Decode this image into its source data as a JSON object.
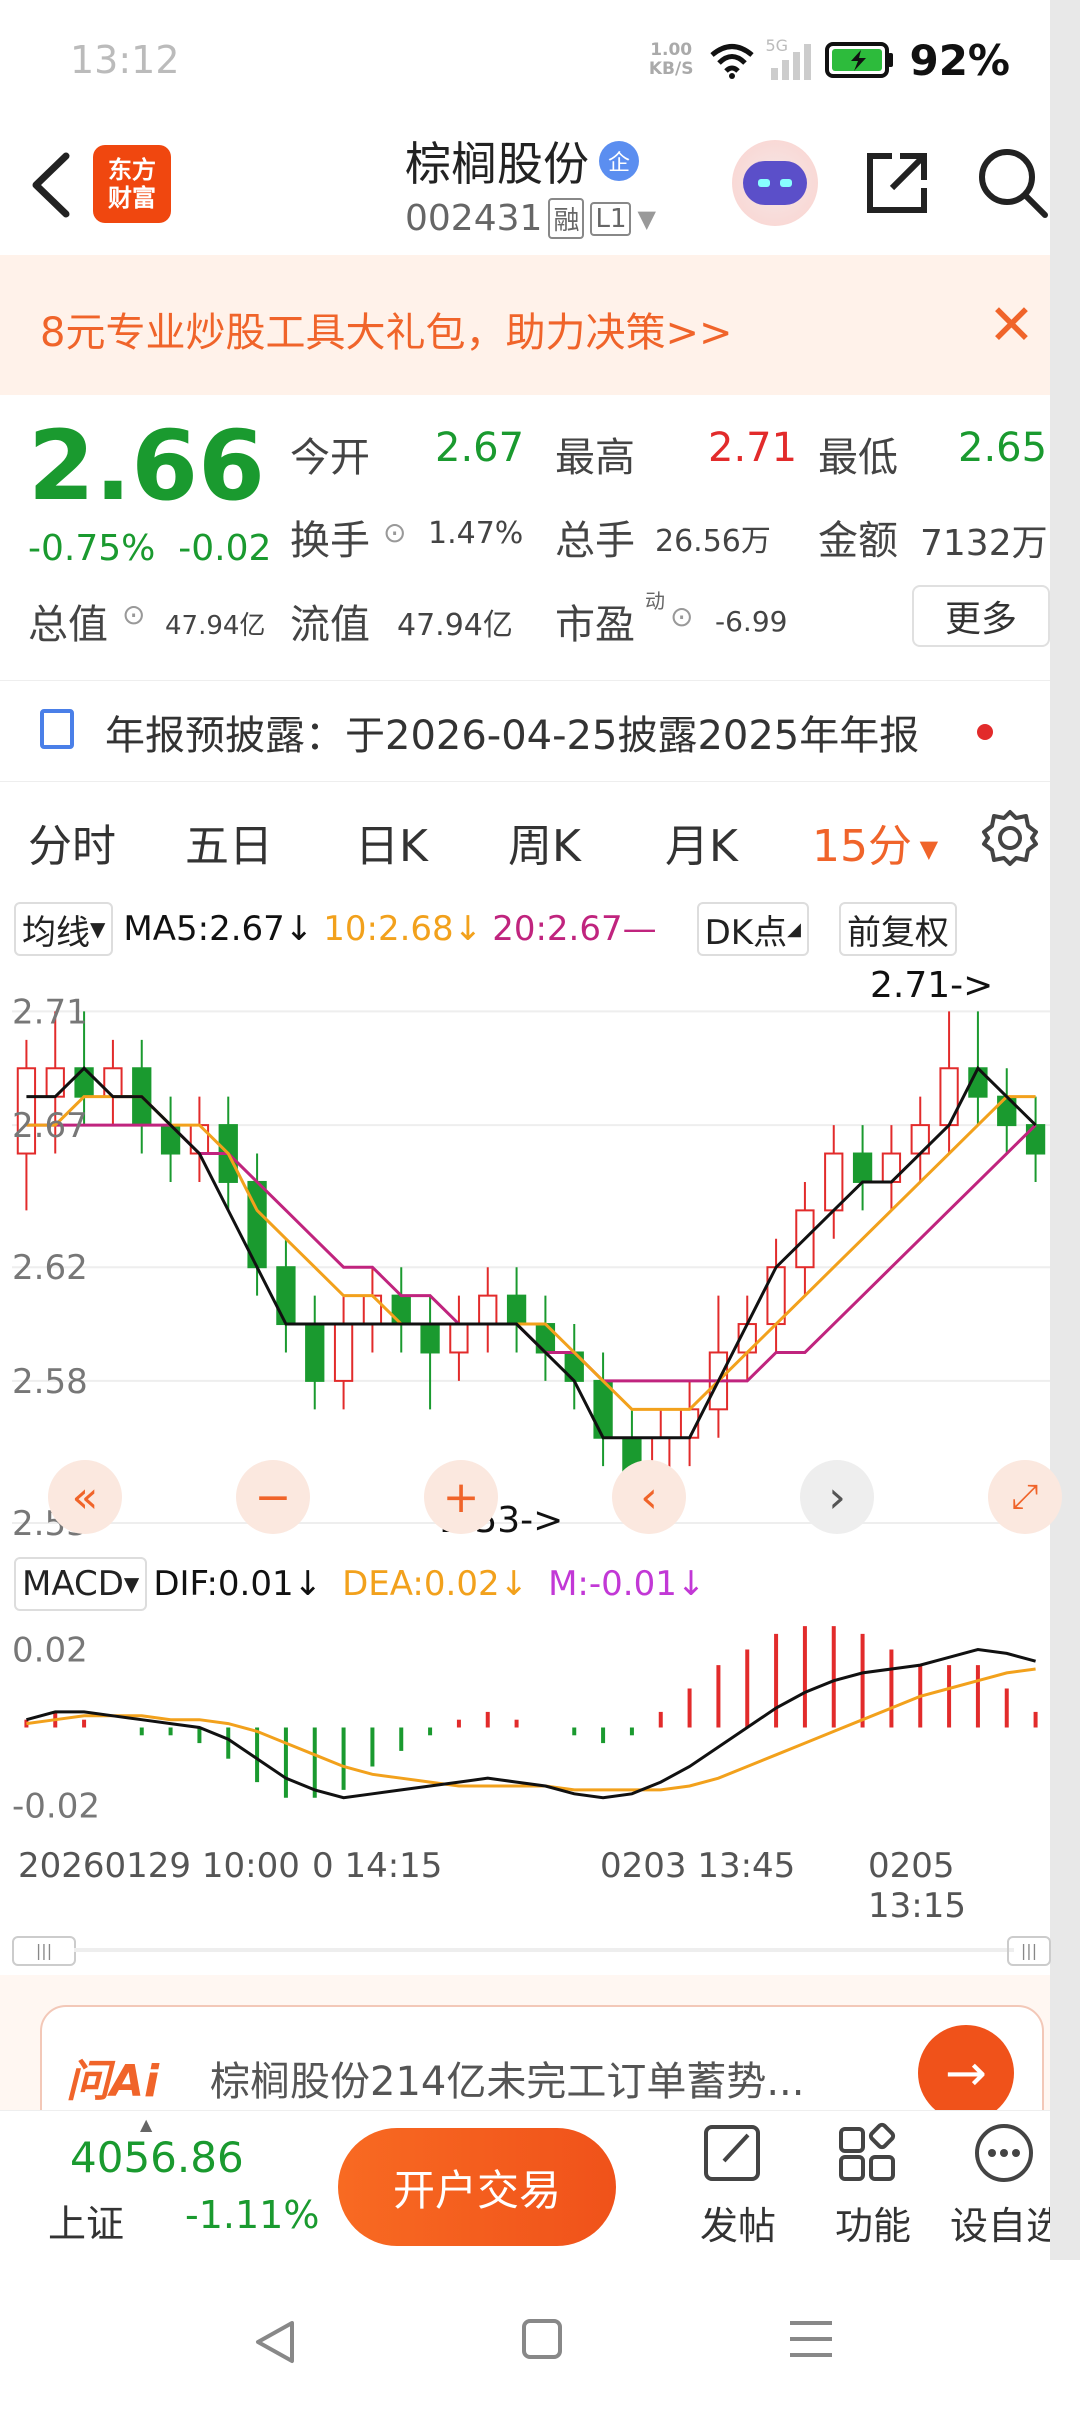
{
  "status": {
    "time": "13:12",
    "net_speed_value": "1.00",
    "net_speed_unit": "KB/S",
    "network": "5G",
    "battery": "92%"
  },
  "header": {
    "back_icon": "back-chevron-icon",
    "logo_line1": "东方",
    "logo_line2": "财富",
    "stock_name": "棕榈股份",
    "badge": "企",
    "code": "002431",
    "tag1": "融",
    "tag2": "L1"
  },
  "banner": {
    "text": "8元专业炒股工具大礼包，助力决策>>"
  },
  "quote": {
    "price": "2.66",
    "change_pct": "-0.75%",
    "change": "-0.02",
    "open_label": "今开",
    "open": "2.67",
    "high_label": "最高",
    "high": "2.71",
    "low_label": "最低",
    "low": "2.65",
    "turnover_label": "换手",
    "turnover": "1.47%",
    "volume_label": "总手",
    "volume": "26.56万",
    "amount_label": "金额",
    "amount": "7132万",
    "mktcap_label": "总值",
    "mktcap": "47.94亿",
    "float_label": "流值",
    "float": "47.94亿",
    "pe_label": "市盈",
    "pe_sup": "动",
    "pe": "-6.99",
    "more": "更多"
  },
  "notice": {
    "text": "年报预披露：于2026-04-25披露2025年年报"
  },
  "tabs": [
    "分时",
    "五日",
    "日K",
    "周K",
    "月K",
    "15分"
  ],
  "legend": {
    "mode": "均线",
    "ma5": "MA5:2.67↓",
    "ma10": "10:2.68↓",
    "ma20": "20:2.67—",
    "dk": "DK点",
    "adjust": "前复权"
  },
  "chart_labels": {
    "high_marker": "2.71->",
    "low_marker": "2.53->"
  },
  "macd": {
    "label": "MACD",
    "dif": "DIF:0.01↓",
    "dea": "DEA:0.02↓",
    "m": "M:-0.01↓"
  },
  "dates": {
    "d1": "20260129 10:00",
    "d2": "0 14:15",
    "d3": "0203 13:45",
    "d4": "0205 13:15"
  },
  "ai": {
    "logo": "问Ai",
    "text": "棕榈股份214亿未完工订单蓄势..."
  },
  "bottom": {
    "index_value": "4056.86",
    "index_name": "上证",
    "index_change": "-1.11%",
    "cta": "开户交易",
    "post": "发帖",
    "func": "功能",
    "custom": "设自选"
  },
  "colors": {
    "up": "#e22b2b",
    "down": "#1a9a2f",
    "ma5": "#111111",
    "ma10": "#f2a11c",
    "ma20": "#c0247e",
    "accent": "#f0642a"
  },
  "chart_data": [
    {
      "type": "candlestick",
      "title": "15分",
      "ylabels": [
        "2.71",
        "2.67",
        "2.62",
        "2.58",
        "2.53"
      ],
      "ylim": [
        2.53,
        2.72
      ],
      "candles": [
        [
          2.66,
          2.69,
          2.7,
          2.64
        ],
        [
          2.68,
          2.69,
          2.71,
          2.66
        ],
        [
          2.69,
          2.68,
          2.71,
          2.67
        ],
        [
          2.68,
          2.69,
          2.7,
          2.67
        ],
        [
          2.69,
          2.67,
          2.7,
          2.66
        ],
        [
          2.67,
          2.66,
          2.68,
          2.65
        ],
        [
          2.66,
          2.67,
          2.68,
          2.65
        ],
        [
          2.67,
          2.65,
          2.68,
          2.64
        ],
        [
          2.65,
          2.62,
          2.66,
          2.61
        ],
        [
          2.62,
          2.6,
          2.63,
          2.59
        ],
        [
          2.6,
          2.58,
          2.61,
          2.57
        ],
        [
          2.58,
          2.6,
          2.61,
          2.57
        ],
        [
          2.6,
          2.61,
          2.62,
          2.59
        ],
        [
          2.61,
          2.6,
          2.62,
          2.59
        ],
        [
          2.6,
          2.59,
          2.61,
          2.57
        ],
        [
          2.59,
          2.6,
          2.61,
          2.58
        ],
        [
          2.6,
          2.61,
          2.62,
          2.59
        ],
        [
          2.61,
          2.6,
          2.62,
          2.59
        ],
        [
          2.6,
          2.59,
          2.61,
          2.58
        ],
        [
          2.59,
          2.58,
          2.6,
          2.57
        ],
        [
          2.58,
          2.56,
          2.59,
          2.55
        ],
        [
          2.56,
          2.54,
          2.57,
          2.53
        ],
        [
          2.54,
          2.56,
          2.57,
          2.54
        ],
        [
          2.56,
          2.57,
          2.58,
          2.55
        ],
        [
          2.57,
          2.59,
          2.61,
          2.56
        ],
        [
          2.59,
          2.6,
          2.61,
          2.58
        ],
        [
          2.6,
          2.62,
          2.63,
          2.59
        ],
        [
          2.62,
          2.64,
          2.65,
          2.61
        ],
        [
          2.64,
          2.66,
          2.67,
          2.63
        ],
        [
          2.66,
          2.65,
          2.67,
          2.64
        ],
        [
          2.65,
          2.66,
          2.67,
          2.64
        ],
        [
          2.66,
          2.67,
          2.68,
          2.65
        ],
        [
          2.67,
          2.69,
          2.71,
          2.66
        ],
        [
          2.69,
          2.68,
          2.71,
          2.67
        ],
        [
          2.68,
          2.67,
          2.69,
          2.66
        ],
        [
          2.67,
          2.66,
          2.68,
          2.65
        ]
      ],
      "ma5": [
        2.68,
        2.68,
        2.69,
        2.68,
        2.68,
        2.67,
        2.66,
        2.64,
        2.62,
        2.6,
        2.6,
        2.6,
        2.6,
        2.6,
        2.6,
        2.6,
        2.6,
        2.6,
        2.59,
        2.58,
        2.56,
        2.56,
        2.56,
        2.56,
        2.58,
        2.6,
        2.62,
        2.63,
        2.64,
        2.65,
        2.65,
        2.66,
        2.67,
        2.69,
        2.68,
        2.67
      ],
      "ma10": [
        2.67,
        2.67,
        2.68,
        2.68,
        2.68,
        2.67,
        2.67,
        2.66,
        2.64,
        2.63,
        2.62,
        2.61,
        2.61,
        2.6,
        2.6,
        2.6,
        2.6,
        2.6,
        2.6,
        2.59,
        2.58,
        2.57,
        2.57,
        2.57,
        2.58,
        2.59,
        2.6,
        2.61,
        2.62,
        2.63,
        2.64,
        2.65,
        2.66,
        2.67,
        2.68,
        2.68
      ],
      "ma20": [
        2.67,
        2.67,
        2.67,
        2.67,
        2.67,
        2.67,
        2.66,
        2.66,
        2.65,
        2.64,
        2.63,
        2.62,
        2.62,
        2.61,
        2.61,
        2.6,
        2.6,
        2.6,
        2.59,
        2.59,
        2.58,
        2.58,
        2.58,
        2.58,
        2.58,
        2.58,
        2.59,
        2.59,
        2.6,
        2.61,
        2.62,
        2.63,
        2.64,
        2.65,
        2.66,
        2.67
      ]
    },
    {
      "type": "macd",
      "ylabels": [
        "0.02",
        "-0.02"
      ],
      "ylim": [
        -0.025,
        0.025
      ],
      "dif": [
        0.002,
        0.004,
        0.004,
        0.003,
        0.002,
        0.001,
        0.0,
        -0.003,
        -0.008,
        -0.013,
        -0.016,
        -0.018,
        -0.017,
        -0.016,
        -0.015,
        -0.014,
        -0.013,
        -0.014,
        -0.015,
        -0.017,
        -0.018,
        -0.017,
        -0.014,
        -0.01,
        -0.005,
        0.0,
        0.005,
        0.009,
        0.012,
        0.014,
        0.015,
        0.016,
        0.018,
        0.02,
        0.019,
        0.017
      ],
      "dea": [
        0.001,
        0.002,
        0.003,
        0.003,
        0.003,
        0.002,
        0.002,
        0.001,
        -0.001,
        -0.004,
        -0.007,
        -0.01,
        -0.012,
        -0.013,
        -0.014,
        -0.015,
        -0.015,
        -0.015,
        -0.015,
        -0.016,
        -0.016,
        -0.016,
        -0.016,
        -0.015,
        -0.013,
        -0.01,
        -0.007,
        -0.004,
        -0.001,
        0.002,
        0.005,
        0.008,
        0.01,
        0.012,
        0.014,
        0.015
      ],
      "m": [
        0.002,
        0.004,
        0.002,
        0.0,
        -0.002,
        -0.002,
        -0.004,
        -0.008,
        -0.014,
        -0.018,
        -0.018,
        -0.016,
        -0.01,
        -0.006,
        -0.002,
        0.002,
        0.004,
        0.002,
        0.0,
        -0.002,
        -0.004,
        -0.002,
        0.004,
        0.01,
        0.016,
        0.02,
        0.024,
        0.026,
        0.026,
        0.024,
        0.02,
        0.016,
        0.016,
        0.016,
        0.01,
        0.004
      ]
    }
  ]
}
